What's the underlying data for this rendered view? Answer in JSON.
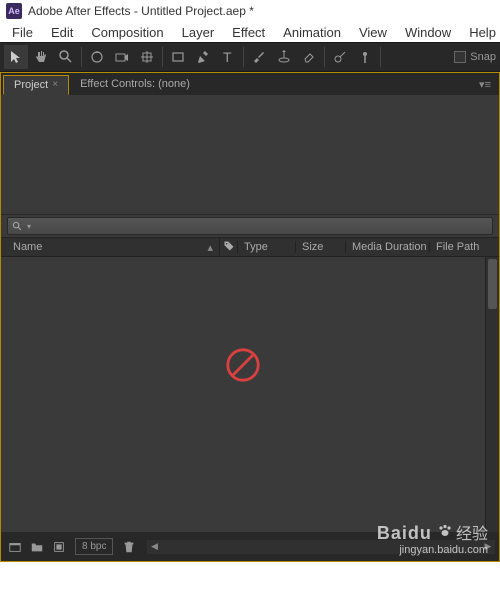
{
  "title": "Adobe After Effects - Untitled Project.aep *",
  "menu": {
    "file": "File",
    "edit": "Edit",
    "composition": "Composition",
    "layer": "Layer",
    "effect": "Effect",
    "animation": "Animation",
    "view": "View",
    "window": "Window",
    "help": "Help"
  },
  "toolbar": {
    "snap_label": "Snap"
  },
  "tabs": {
    "project": "Project",
    "effect_controls": "Effect Controls: (none)"
  },
  "search": {
    "placeholder": ""
  },
  "columns": {
    "name": "Name",
    "type": "Type",
    "size": "Size",
    "media_duration": "Media Duration",
    "file_path": "File Path"
  },
  "footer": {
    "bpc": "8 bpc"
  },
  "watermark": {
    "brand": "Baidu",
    "product": "经验",
    "url": "jingyan.baidu.com"
  }
}
